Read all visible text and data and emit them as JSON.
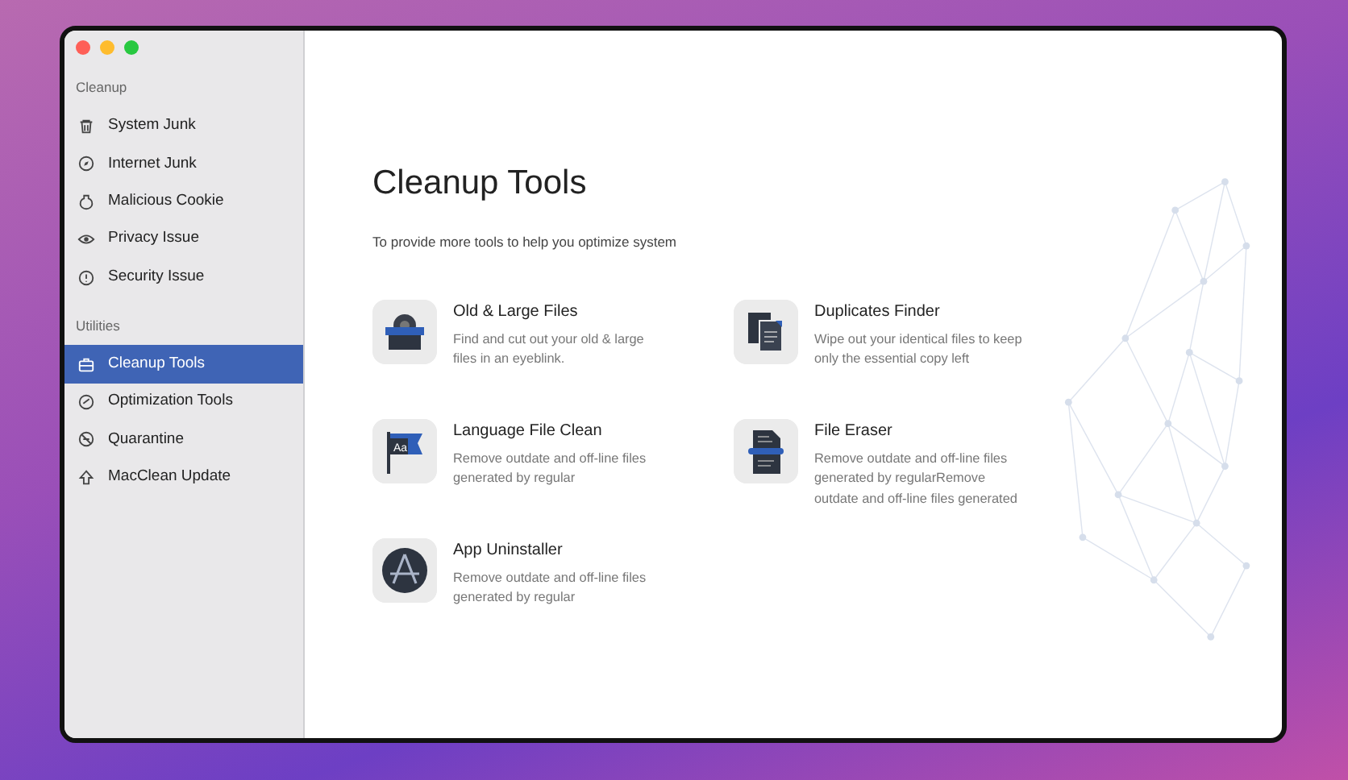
{
  "sidebar": {
    "sections": [
      {
        "heading": "Cleanup",
        "items": [
          {
            "label": "System Junk",
            "selected": false
          },
          {
            "label": "Internet Junk",
            "selected": false
          },
          {
            "label": "Malicious Cookie",
            "selected": false
          },
          {
            "label": "Privacy Issue",
            "selected": false
          },
          {
            "label": "Security Issue",
            "selected": false
          }
        ]
      },
      {
        "heading": "Utilities",
        "items": [
          {
            "label": "Cleanup Tools",
            "selected": true
          },
          {
            "label": "Optimization Tools",
            "selected": false
          },
          {
            "label": "Quarantine",
            "selected": false
          },
          {
            "label": "MacClean Update",
            "selected": false
          }
        ]
      }
    ]
  },
  "main": {
    "title": "Cleanup Tools",
    "subtitle": "To provide more tools to help you optimize system",
    "tools": [
      {
        "kind": "oldlarge",
        "name": "Old & Large Files",
        "description": "Find and cut out your old & large files in an eyeblink."
      },
      {
        "kind": "duplicates",
        "name": "Duplicates Finder",
        "description": "Wipe out your identical files to keep only the essential copy left"
      },
      {
        "kind": "language",
        "icon_text": "Aa",
        "name": "Language File Clean",
        "description": "Remove outdate and off-line files generated by regular"
      },
      {
        "kind": "eraser",
        "name": "File Eraser",
        "description": "Remove outdate and off-line files generated by regularRemove outdate and off-line files generated"
      },
      {
        "kind": "uninstaller",
        "name": "App Uninstaller",
        "description": "Remove outdate and off-line files generated by regular"
      }
    ]
  }
}
